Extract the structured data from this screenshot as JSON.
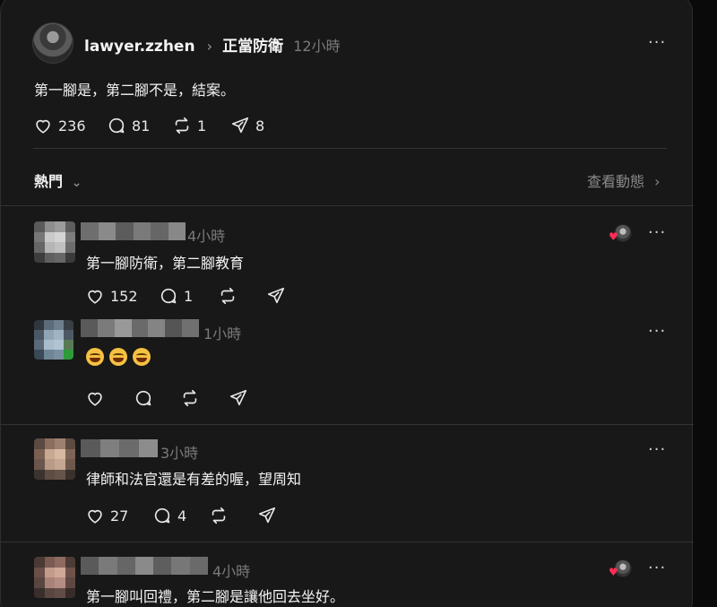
{
  "post": {
    "username": "lawyer.zzhen",
    "crumb_separator": "›",
    "topic": "正當防衛",
    "time": "12小時",
    "more": "···",
    "text": "第一腳是，第二腳不是，結案。",
    "likes": "236",
    "comments": "81",
    "reposts": "1",
    "shares": "8"
  },
  "sort": {
    "label": "熱門",
    "chevron": "⌄",
    "activity_link": "查看動態",
    "activity_chevron": "›"
  },
  "replies": [
    {
      "time": "4小時",
      "text": "第一腳防衛，第二腳教育",
      "likes": "152",
      "comments": "1",
      "liked_by_author": true
    },
    {
      "time": "1小時",
      "emoji_count": 3,
      "liked_by_author": false
    },
    {
      "time": "3小時",
      "text": "律師和法官還是有差的喔，望周知",
      "likes": "27",
      "comments": "4",
      "liked_by_author": false
    },
    {
      "time": "4小時",
      "text": "第一腳叫回禮，第二腳是讓他回去坐好。",
      "liked_by_author": true
    }
  ],
  "icons": {
    "like": "heart-icon",
    "comment": "comment-bubble-icon",
    "repost": "repost-icon",
    "share": "send-icon",
    "more": "more-dots-icon"
  },
  "colors": {
    "background": "#181818",
    "text": "#f3f3f3",
    "muted": "#7a7a7a",
    "heart": "#ff2d55"
  }
}
